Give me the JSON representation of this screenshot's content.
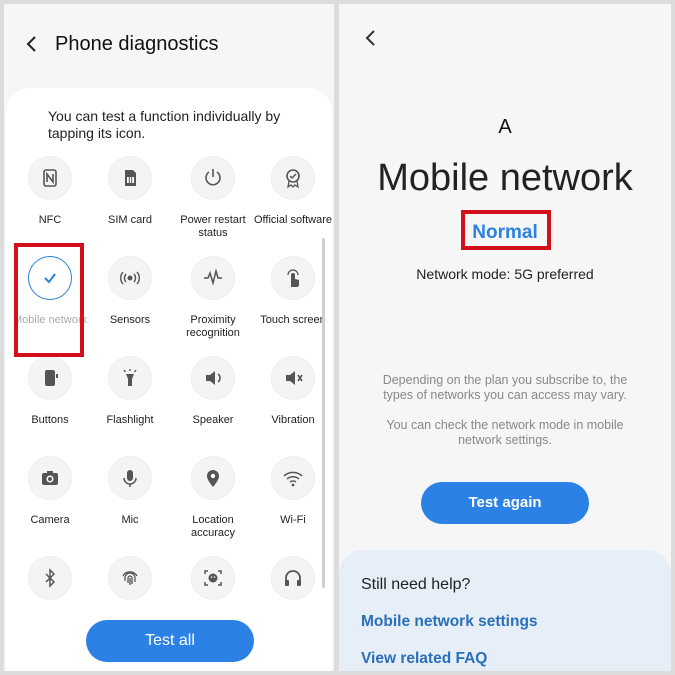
{
  "left": {
    "title": "Phone diagnostics",
    "intro": "You can test a function individually by tapping its icon.",
    "tests": [
      {
        "label": "NFC",
        "icon": "nfc-icon"
      },
      {
        "label": "SIM card",
        "icon": "sim-card-icon"
      },
      {
        "label": "Power restart status",
        "icon": "power-restart-icon"
      },
      {
        "label": "Official software",
        "icon": "official-software-icon"
      },
      {
        "label": "Mobile network",
        "icon": "checkmark-icon",
        "selected": true
      },
      {
        "label": "Sensors",
        "icon": "sensors-icon"
      },
      {
        "label": "Proximity recognition",
        "icon": "proximity-icon"
      },
      {
        "label": "Touch screen",
        "icon": "touch-screen-icon"
      },
      {
        "label": "Buttons",
        "icon": "buttons-icon"
      },
      {
        "label": "Flashlight",
        "icon": "flashlight-icon"
      },
      {
        "label": "Speaker",
        "icon": "speaker-icon"
      },
      {
        "label": "Vibration",
        "icon": "vibration-icon"
      },
      {
        "label": "Camera",
        "icon": "camera-icon"
      },
      {
        "label": "Mic",
        "icon": "mic-icon"
      },
      {
        "label": "Location accuracy",
        "icon": "location-icon"
      },
      {
        "label": "Wi-Fi",
        "icon": "wifi-icon"
      },
      {
        "label": "",
        "icon": "bluetooth-icon"
      },
      {
        "label": "",
        "icon": "fingerprint-icon"
      },
      {
        "label": "",
        "icon": "face-recognition-icon"
      },
      {
        "label": "",
        "icon": "headphones-icon"
      }
    ],
    "test_all_label": "Test all"
  },
  "right": {
    "network_glyph": "A",
    "title": "Mobile network",
    "status": "Normal",
    "network_mode": "Network mode: 5G preferred",
    "note1": "Depending on the plan you subscribe to, the types of networks you can access may vary.",
    "note2": "You can check the network mode in mobile network settings.",
    "test_again_label": "Test again",
    "help": {
      "title": "Still need help?",
      "link1": "Mobile network settings",
      "link2": "View related FAQ"
    }
  },
  "colors": {
    "accent": "#2b82e4",
    "link": "#2a6fb9",
    "highlight_red": "#d31019",
    "help_bg": "#e6eef7"
  }
}
